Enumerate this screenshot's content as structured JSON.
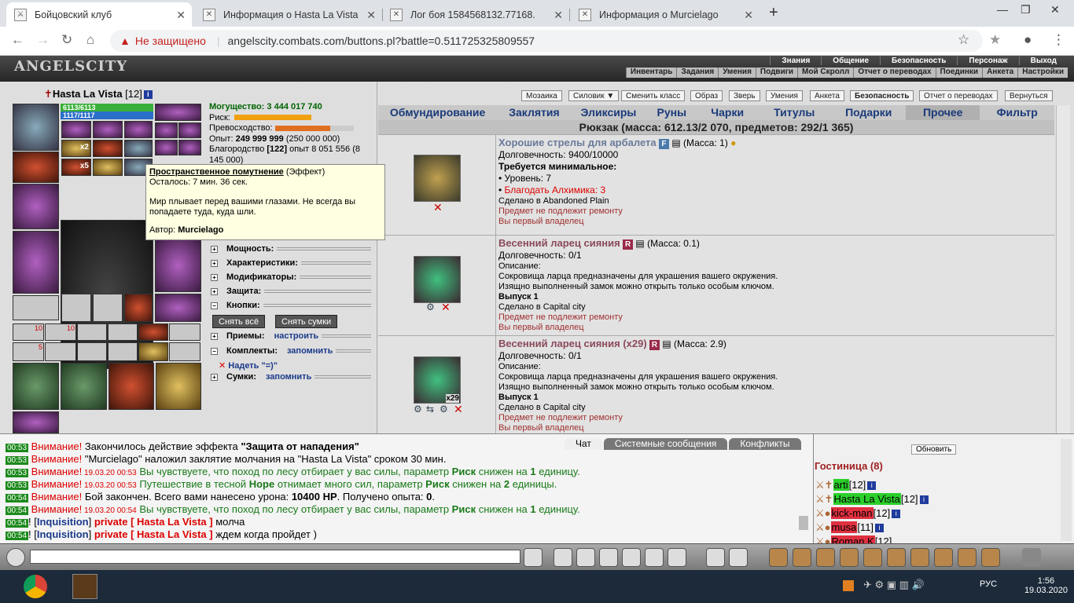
{
  "browser": {
    "tabs": [
      {
        "title": "Бойцовский клуб"
      },
      {
        "title": "Информация о Hasta La Vista"
      },
      {
        "title": "Лог боя 1584568132.77168."
      },
      {
        "title": "Информация о Murcielago"
      }
    ],
    "security": "Не защищено",
    "url": "angelscity.combats.com/buttons.pl?battle=0.511725325809557"
  },
  "game": {
    "logo": "ANGELSCITY",
    "menu_top": [
      "Знания",
      "Общение",
      "Безопасность",
      "Персонаж",
      "Выход"
    ],
    "menu_sub": [
      "Инвентарь",
      "Задания",
      "Умения",
      "Подвиги",
      "Мой Скролл",
      "Отчет о переводах",
      "Поединки",
      "Анкета",
      "Настройки"
    ]
  },
  "character": {
    "name": "Hasta La Vista",
    "level": "[12]",
    "hp": "6113/6113",
    "mp": "1117/1117",
    "power_label": "Могущество:",
    "power": "3 444 017 740",
    "risk_label": "Риск:",
    "excellence_label": "Превосходство:",
    "exp_label": "Опыт:",
    "exp": "249 999 999",
    "exp_next": "(250 000 000)",
    "nobility_label": "Благородство",
    "nobility": "[122]",
    "nobility_exp": "опыт 8 051 556 (8 145 000)",
    "count_x2": "x2",
    "count_x5": "x5",
    "count_10a": "10",
    "count_10b": "10",
    "count_5": "5"
  },
  "sections": {
    "power": "Мощность:",
    "chars": "Характеристики:",
    "mods": "Модификаторы:",
    "protect": "Защита:",
    "buttons": "Кнопки:",
    "remove_all": "Снять всё",
    "remove_bags": "Снять сумки",
    "tricks": "Приемы:",
    "tricks_link": "настроить",
    "sets": "Комплекты:",
    "sets_link": "запомнить",
    "wear": "Надеть \"=)\"",
    "bags": "Сумки:",
    "bags_link": "запомнить"
  },
  "tooltip": {
    "title": "Пространственное помутнение",
    "type": "(Эффект)",
    "remain": "Осталось: 7 мин. 36 сек.",
    "desc": "Мир плывает перед вашими глазами. Не всегда вы попадаете туда, куда шли.",
    "author_label": "Автор:",
    "author": "Murcielago"
  },
  "inventory": {
    "top_buttons": [
      "Мозаика",
      "Силовик ▼",
      "Сменить класс",
      "Образ",
      "Зверь",
      "Умения",
      "Анкета",
      "Безопасность",
      "Отчет о переводах",
      "Вернуться"
    ],
    "tabs": [
      "Обмундирование",
      "Заклятия",
      "Эликсиры",
      "Руны",
      "Чарки",
      "Титулы",
      "Подарки",
      "Прочее",
      "Фильтр"
    ],
    "selected_tab": "Прочее",
    "backpack": "Рюкзак (масса: 612.13/2 070, предметов: 292/1 365)",
    "items": [
      {
        "name": "Хорошие стрелы для арбалета",
        "badge": "F",
        "mass": "(Масса: 1)",
        "durability": "Долговечность: 9400/10000",
        "req": "Требуется минимальное:",
        "req_level": "• Уровень: 7",
        "req_bless": "Благодать Алхимика: 3",
        "made": "Сделано в Abandoned Plain",
        "norepair": "Предмет не подлежит ремонту",
        "owner": "Вы первый владелец"
      },
      {
        "name": "Весенний ларец сияния",
        "badge": "R",
        "mass": "(Масса: 0.1)",
        "durability": "Долговечность: 0/1",
        "desc_label": "Описание:",
        "desc1": "Сокровища ларца предназначены для украшения вашего окружения.",
        "desc2": "Изящно выполненный замок можно открыть только особым ключом.",
        "release": "Выпуск 1",
        "made": "Сделано в Capital city",
        "norepair": "Предмет не подлежит ремонту",
        "owner": "Вы первый владелец"
      },
      {
        "name": "Весенний ларец сияния (x29)",
        "badge": "R",
        "mass": "(Масса: 2.9)",
        "durability": "Долговечность: 0/1",
        "desc_label": "Описание:",
        "desc1": "Сокровища ларца предназначены для украшения вашего окружения.",
        "desc2": "Изящно выполненный замок можно открыть только особым ключом.",
        "release": "Выпуск 1",
        "made": "Сделано в Capital city",
        "norepair": "Предмет не подлежит ремонту",
        "owner": "Вы первый владелец",
        "count": "x29"
      }
    ]
  },
  "chat": {
    "tabs": [
      "Чат",
      "Системные сообщения",
      "Конфликты"
    ],
    "lines": [
      {
        "t": "00:53",
        "a": "Внимание!",
        "m": " Закончилось действие эффекта ",
        "b": "\"Защита от нападения\""
      },
      {
        "t": "00:53",
        "a": "Внимание!",
        "m": " \"Murcielago\" наложил заклятие молчания на \"Hasta La Vista\" сроком 30 мин."
      },
      {
        "t": "00:53",
        "a": "Внимание!",
        "d": " 19.03.20 00:53",
        "g1": " Вы чувствуете, что поход по лесу отбирает у вас силы, параметр ",
        "gb1": "Риск",
        "g2": " снижен на ",
        "gb2": "1",
        "g3": " единицу."
      },
      {
        "t": "00:53",
        "a": "Внимание!",
        "d": " 19.03.20 00:53",
        "g1": " Путешествие в тесной ",
        "gb1": "Норе",
        "g2": " отнимает много сил, параметр ",
        "gb2": "Риск",
        "g3": " снижен на ",
        "gb3": "2",
        "g4": " единицы."
      },
      {
        "t": "00:54",
        "a": "Внимание!",
        "m": " Бой закончен. Всего вами нанесено урона: ",
        "b": "10400 HP",
        "m2": ". Получено опыта: ",
        "b2": "0",
        "m3": "."
      },
      {
        "t": "00:54",
        "a": "Внимание!",
        "d": " 19.03.20 00:54",
        "g1": " Вы чувствуете, что поход по лесу отбирает у вас силы, параметр ",
        "gb1": "Риск",
        "g2": " снижен на ",
        "gb2": "1",
        "g3": " единицу."
      },
      {
        "t": "00:54",
        "p1": "! [",
        "inq": "Inquisition",
        "p2": "] ",
        "priv": "private [ Hasta La Vista ]",
        "msg": " молча"
      },
      {
        "t": "00:54",
        "p1": "! [",
        "inq": "Inquisition",
        "p2": "] ",
        "priv": "private [ Hasta La Vista ]",
        "msg": " ждем когда пройдет )"
      }
    ]
  },
  "guests": {
    "refresh": "Обновить",
    "title": "Гостиница (8)",
    "list": [
      {
        "name": "arti",
        "level": "[12]",
        "color": "#2bd02b"
      },
      {
        "name": "Hasta La Vista",
        "level": "[12]",
        "color": "#2bd02b"
      },
      {
        "name": "kick-man",
        "level": "[12]",
        "color": "#e03040"
      },
      {
        "name": "musa",
        "level": "[11]",
        "color": "#e03040"
      },
      {
        "name": "Roman K",
        "level": "[12]",
        "color": "#e03040"
      }
    ]
  },
  "taskbar": {
    "lang": "РУС",
    "time": "1:56",
    "date": "19.03.2020"
  }
}
